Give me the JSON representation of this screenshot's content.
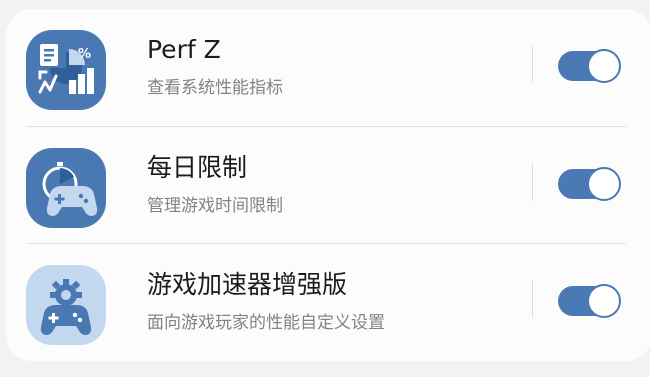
{
  "settings": {
    "items": [
      {
        "title": "Perf Z",
        "subtitle": "查看系统性能指标",
        "enabled": true,
        "icon": "performance-chart-icon"
      },
      {
        "title": "每日限制",
        "subtitle": "管理游戏时间限制",
        "enabled": true,
        "icon": "gamepad-timer-icon"
      },
      {
        "title": "游戏加速器增强版",
        "subtitle": "面向游戏玩家的性能自定义设置",
        "enabled": true,
        "icon": "gamepad-gear-icon"
      }
    ]
  },
  "colors": {
    "card_background": "#fcfcfd",
    "page_background": "#f2f2f4",
    "toggle_on": "#4b79b4",
    "icon_dark_blue": "#4a78b3",
    "icon_light_blue": "#c3d7ee"
  }
}
